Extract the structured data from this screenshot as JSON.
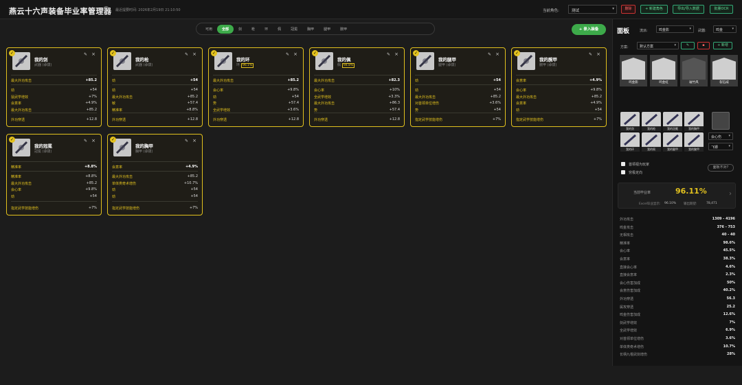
{
  "app": {
    "title": "燕云十六声装备毕业率管理器",
    "info_icon": "i",
    "last_saved": "最近提要时间: 2026年2月19日 21:10:50"
  },
  "header": {
    "role_label": "当前角色:",
    "role_value": "测试",
    "delete_label": "删除",
    "new_role_label": "+ 新建角色",
    "export_label": "导出/导入数据",
    "ocr_label": "批量OCR"
  },
  "tabs": [
    "可用",
    "全部",
    "剑",
    "枪",
    "环",
    "佩",
    "冠冕",
    "胸甲",
    "腿甲",
    "腕甲"
  ],
  "active_tab": "全部",
  "add_equip_label": "+ 录入装备",
  "accent_colors": {
    "card_border": "#e3c21e",
    "green": "#3daa4a",
    "red": "#cc3333"
  },
  "cards": [
    {
      "name": "我的剑",
      "sub": "武器 (承拨)",
      "pct": "",
      "main": [
        "最大外功攻击",
        "+85.2"
      ],
      "rows": [
        [
          "劲",
          "+54"
        ],
        [
          "鼠武学增效",
          "+7%"
        ],
        [
          "会意率",
          "+4.9%"
        ],
        [
          "最大外功攻击",
          "+85.2"
        ]
      ],
      "foot": [
        "外功穿透",
        "+12.8"
      ]
    },
    {
      "name": "我的枪",
      "sub": "武器 (承拨)",
      "pct": "",
      "main": [
        "劲",
        "+54"
      ],
      "rows": [
        [
          "劲",
          "+54"
        ],
        [
          "最大外功攻击",
          "+85.2"
        ],
        [
          "敏",
          "+57.4"
        ],
        [
          "精准率",
          "+8.8%"
        ]
      ],
      "foot": [
        "外功穿透",
        "+12.8"
      ]
    },
    {
      "name": "我的环",
      "sub": "环",
      "pct": "96.1%",
      "main": [
        "最大外功攻击",
        "+85.2"
      ],
      "rows": [
        [
          "会心率",
          "+9.8%"
        ],
        [
          "劲",
          "+54"
        ],
        [
          "势",
          "+57.4"
        ],
        [
          "全武学增效",
          "+3.6%"
        ]
      ],
      "foot": [
        "外功穿透",
        "+12.8"
      ]
    },
    {
      "name": "我的佩",
      "sub": "佩",
      "pct": "94.8%",
      "main": [
        "最大外功攻击",
        "+82.3"
      ],
      "rows": [
        [
          "会心率",
          "+10%"
        ],
        [
          "全武学增效",
          "+3.3%"
        ],
        [
          "最大外功攻击",
          "+86.3"
        ],
        [
          "势",
          "+57.4"
        ]
      ],
      "foot": [
        "外功穿透",
        "+12.8"
      ]
    },
    {
      "name": "我的腿甲",
      "sub": "腿甲 (承拨)",
      "pct": "",
      "main": [
        "劲",
        "+54"
      ],
      "rows": [
        [
          "劲",
          "+54"
        ],
        [
          "最大外功攻击",
          "+85.2"
        ],
        [
          "对首领单位增伤",
          "+3.6%"
        ],
        [
          "势",
          "+54"
        ]
      ],
      "foot": [
        "指定武学技能增伤",
        "+7%"
      ]
    },
    {
      "name": "我的腕甲",
      "sub": "腕甲 (承拨)",
      "pct": "",
      "main": [
        "会意率",
        "+4.9%"
      ],
      "rows": [
        [
          "会心率",
          "+9.8%"
        ],
        [
          "最大外功攻击",
          "+85.2"
        ],
        [
          "会意率",
          "+4.9%"
        ],
        [
          "劲",
          "+54"
        ]
      ],
      "foot": [
        "指定武学技能增伤",
        "+7%"
      ]
    },
    {
      "name": "我的冠冕",
      "sub": "冠冕 (承拨)",
      "pct": "",
      "main": [
        "精准率",
        "+8.8%"
      ],
      "rows": [
        [
          "精准率",
          "+8.8%"
        ],
        [
          "最大外功攻击",
          "+85.2"
        ],
        [
          "会心率",
          "+9.8%"
        ],
        [
          "劲",
          "+54"
        ]
      ],
      "foot": [
        "指定武学技能增伤",
        "+7%"
      ]
    },
    {
      "name": "我的胸甲",
      "sub": "胸甲 (承拨)",
      "pct": "",
      "main": [
        "会意率",
        "+4.9%"
      ],
      "rows": [
        [
          "最大外功攻击",
          "+85.2"
        ],
        [
          "单体类奇术增伤",
          "+10.7%"
        ],
        [
          "劲",
          "+54"
        ],
        [
          "劲",
          "+54"
        ]
      ],
      "foot": [
        "指定武学技能增伤",
        "+7%"
      ]
    }
  ],
  "panel": {
    "title": "面板",
    "school_label": "流派:",
    "school_value": "鸣金影",
    "weapon_label": "武器:",
    "weapon_value": "鸣金",
    "plan_label": "方案:",
    "plan_value": "默认方案",
    "new_plan_label": "+ 新增",
    "schools": [
      "鸣金影",
      "鸣金虹",
      "破竹风",
      "裂石威"
    ],
    "slots": [
      "我的剑",
      "我的枪",
      "我的冠冕",
      "我的胸甲",
      "我的环",
      "我的佩",
      "我的腿甲",
      "我的腕甲"
    ],
    "opt1": "会心伤",
    "opt2": "飞镖",
    "check1": "首领视为玩家",
    "check2": "穷极定向",
    "check_btn": "面板不对?",
    "rate_label": "当前毕业率",
    "rate_value": "96.11%",
    "excel_label": "Excel毕业显示:",
    "excel_value": "96.10%",
    "base_label": "输出期望:",
    "base_value": "78,471",
    "stats": [
      [
        "外功攻击",
        "1309 - 4196"
      ],
      [
        "鸣金攻击",
        "376 - 753"
      ],
      [
        "无相攻击",
        "40 - 40"
      ],
      [
        "精准率",
        "98.6%"
      ],
      [
        "会心率",
        "45.5%"
      ],
      [
        "会意率",
        "38.3%"
      ],
      [
        "直接会心率",
        "4.6%"
      ],
      [
        "直接会意率",
        "2.3%"
      ],
      [
        "会心伤害加成",
        "50%"
      ],
      [
        "会意伤害加成",
        "40.2%"
      ],
      [
        "外功穿透",
        "56.3"
      ],
      [
        "属攻穿透",
        "25.2"
      ],
      [
        "鸣金伤害加成",
        "12.6%"
      ],
      [
        "剑武学增效",
        "7%"
      ],
      [
        "全武学增效",
        "6.9%"
      ],
      [
        "对首领单位增伤",
        "3.6%"
      ],
      [
        "单体类奇术增伤",
        "10.7%"
      ],
      [
        "长柄九棍武剑增伤",
        "28%"
      ]
    ]
  }
}
